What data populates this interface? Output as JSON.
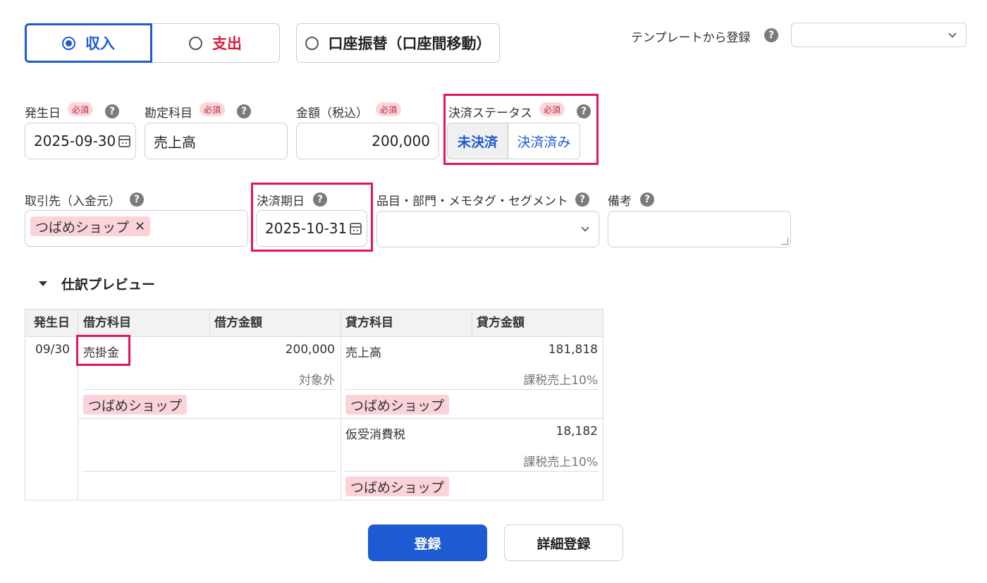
{
  "type_tabs": {
    "income": "収入",
    "expense": "支出",
    "transfer": "口座振替（口座間移動）"
  },
  "template": {
    "label": "テンプレートから登録",
    "value": ""
  },
  "fields": {
    "date": {
      "label": "発生日",
      "required": "必須",
      "value": "2025-09-30"
    },
    "account": {
      "label": "勘定科目",
      "required": "必須",
      "value": "売上高"
    },
    "amount": {
      "label": "金額（税込）",
      "required": "必須",
      "value": "200,000"
    },
    "status": {
      "label": "決済ステータス",
      "required": "必須",
      "option_unsettled": "未決済",
      "option_settled": "決済済み",
      "selected": "未決済"
    },
    "partner": {
      "label": "取引先（入金元）",
      "tag": "つばめショップ",
      "remove": "✕"
    },
    "due_date": {
      "label": "決済期日",
      "value": "2025-10-31"
    },
    "items": {
      "label": "品目・部門・メモタグ・セグメント",
      "value": ""
    },
    "memo": {
      "label": "備考",
      "value": ""
    }
  },
  "preview": {
    "toggle": "仕訳プレビュー",
    "headers": [
      "発生日",
      "借方科目",
      "借方金額",
      "貸方科目",
      "貸方金額"
    ],
    "date": "09/30",
    "rows": [
      {
        "debit_account": "売掛金",
        "debit_amount": "200,000",
        "debit_tax": "対象外",
        "debit_partner": "つばめショップ",
        "credit_account": "売上高",
        "credit_amount": "181,818",
        "credit_tax": "課税売上10%",
        "credit_partner": "つばめショップ"
      },
      {
        "debit_account": "",
        "debit_amount": "",
        "debit_tax": "",
        "debit_partner": "",
        "credit_account": "仮受消費税",
        "credit_amount": "18,182",
        "credit_tax": "課税売上10%",
        "credit_partner": "つばめショップ"
      }
    ]
  },
  "buttons": {
    "register": "登録",
    "detail_register": "詳細登録"
  },
  "colors": {
    "accent": "#1e5ad2",
    "expense": "#d81b3f",
    "highlight": "#e3165b",
    "tag_bg": "#fbd3d8",
    "required_bg": "#fbd7db"
  },
  "icons": [
    "help-icon",
    "calendar-icon",
    "chevron-down-icon",
    "caret-down-icon",
    "close-icon"
  ]
}
